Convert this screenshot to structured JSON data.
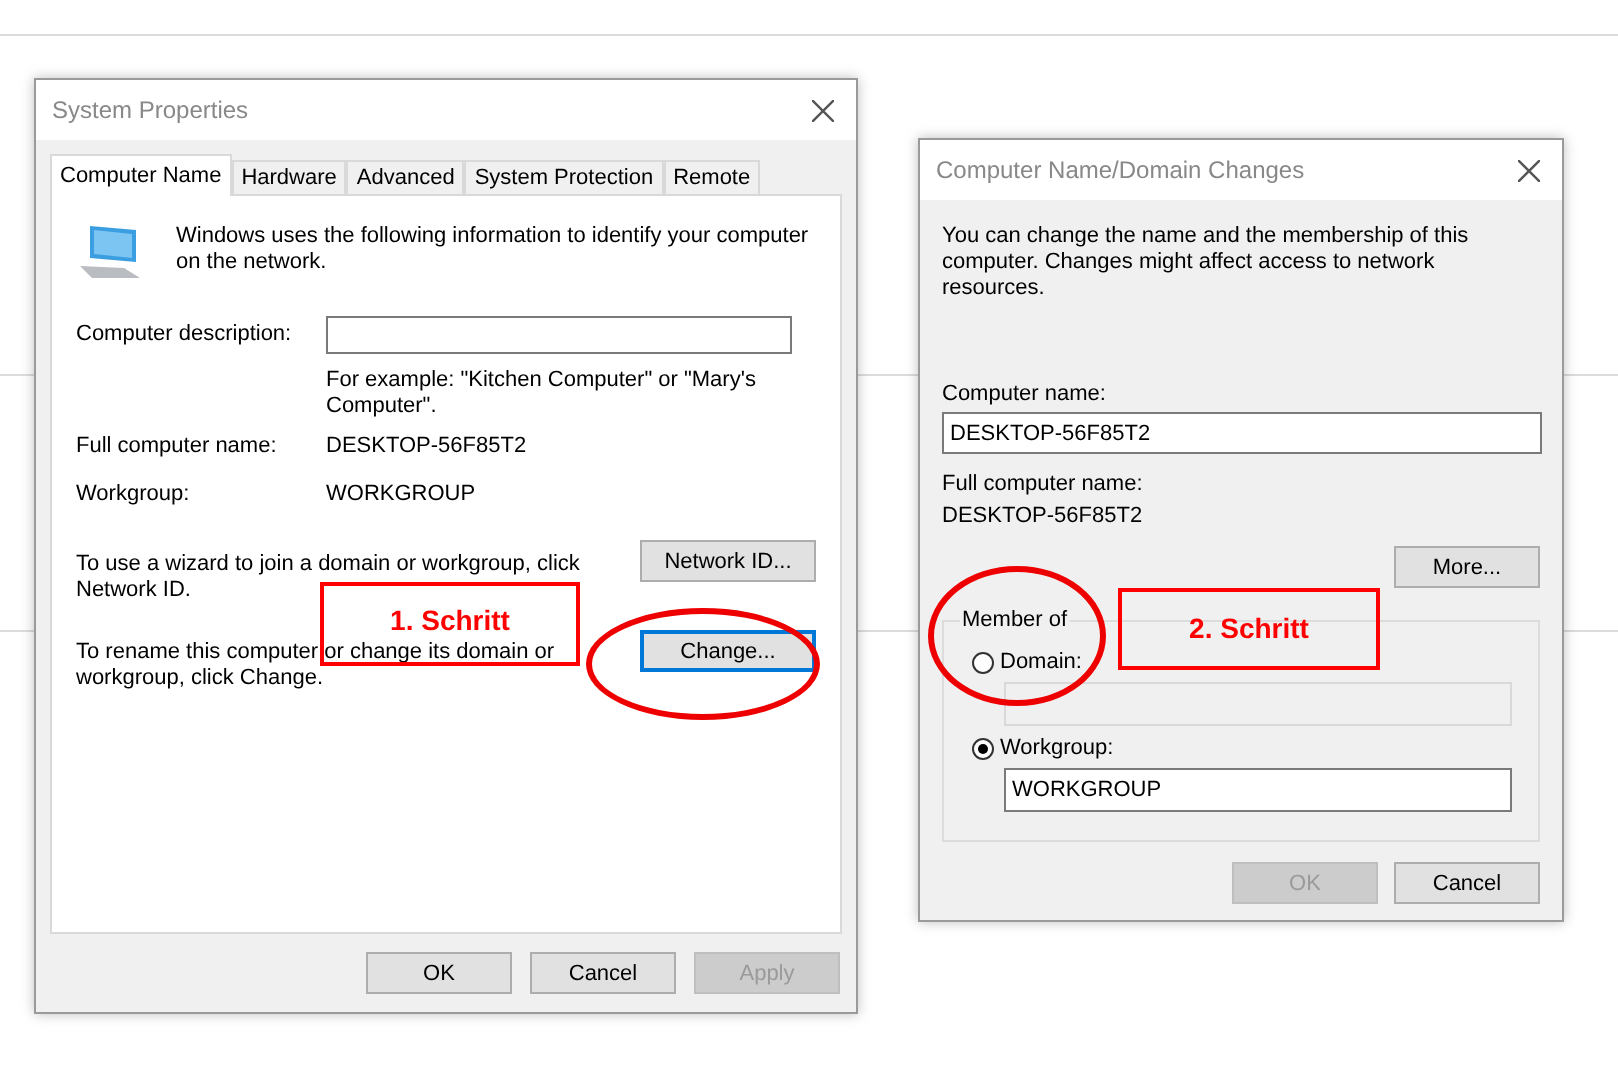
{
  "system_properties": {
    "title": "System Properties",
    "tabs": [
      {
        "label": "Computer Name",
        "selected": true
      },
      {
        "label": "Hardware",
        "selected": false
      },
      {
        "label": "Advanced",
        "selected": false
      },
      {
        "label": "System Protection",
        "selected": false
      },
      {
        "label": "Remote",
        "selected": false
      }
    ],
    "intro": "Windows uses the following information to identify your computer on the network.",
    "description_label": "Computer description:",
    "hint": "For example: \"Kitchen Computer\" or \"Mary's Computer\".",
    "full_name_label": "Full computer name:",
    "full_name": "DESKTOP-56F85T2",
    "workgroup_label": "Workgroup:",
    "workgroup": "WORKGROUP",
    "network_text": "To use a wizard to join a domain or workgroup, click Network ID.",
    "network_button": {
      "label": "Network ID...",
      "focused": false
    },
    "rename_text": "To rename this computer or change its domain or workgroup, click Change.",
    "change_button": {
      "label": "Change...",
      "focused": true
    },
    "buttons": [
      {
        "label": "OK",
        "disabled": false
      },
      {
        "label": "Cancel",
        "disabled": false
      },
      {
        "label": "Apply",
        "disabled": true
      }
    ]
  },
  "name_changes": {
    "title": "Computer Name/Domain Changes",
    "intro": "You can change the name and the membership of this computer. Changes might affect access to network resources.",
    "computer_name_label": "Computer name:",
    "computer_name": "DESKTOP-56F85T2",
    "full_name_label": "Full computer name:",
    "full_name": "DESKTOP-56F85T2",
    "more_button": "More...",
    "member_of": "Member of",
    "options": [
      {
        "label": "Domain:",
        "selected": false
      },
      {
        "label": "Workgroup:",
        "selected": true,
        "value": "WORKGROUP"
      }
    ],
    "buttons": [
      {
        "label": "OK",
        "disabled": true
      },
      {
        "label": "Cancel",
        "disabled": false
      }
    ]
  },
  "annotations": [
    {
      "label": "1. Schritt"
    },
    {
      "label": "2. Schritt"
    }
  ]
}
